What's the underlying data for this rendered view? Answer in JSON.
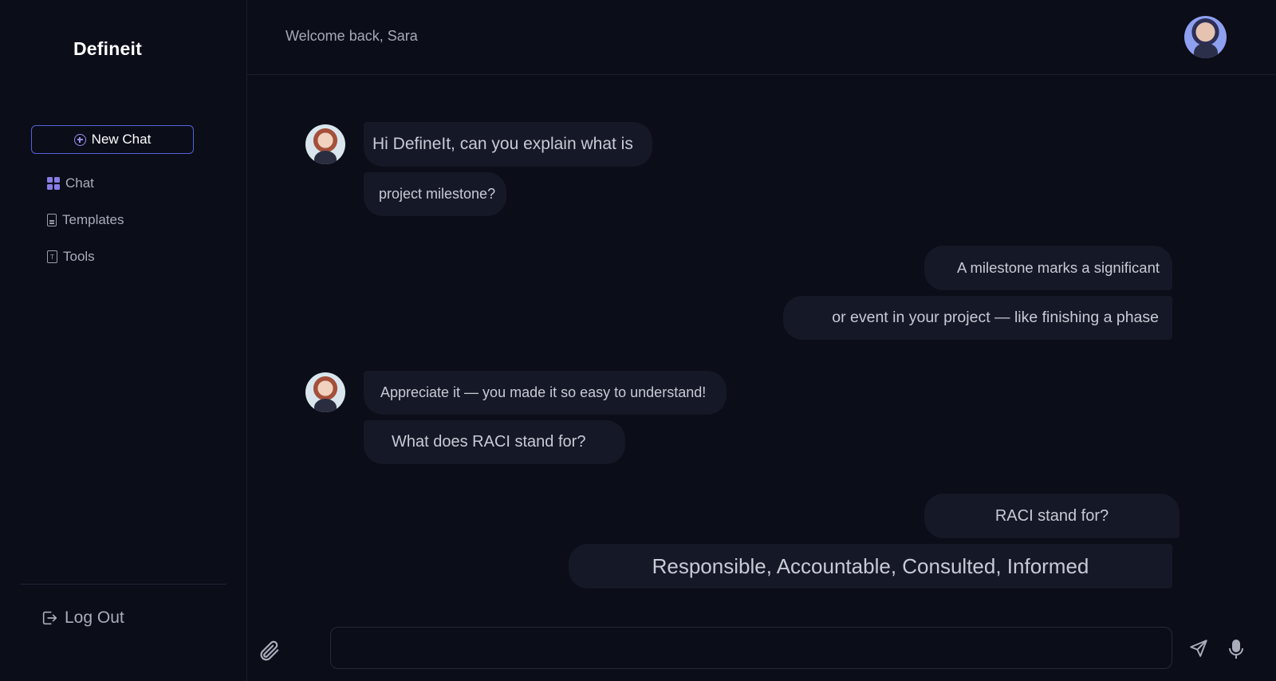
{
  "app": {
    "name": "Defineit"
  },
  "sidebar": {
    "new_chat_label": "New Chat",
    "items": [
      {
        "label": "Chat",
        "icon": "grid-icon"
      },
      {
        "label": "Templates",
        "icon": "document-icon"
      },
      {
        "label": "Tools",
        "icon": "tools-icon"
      }
    ],
    "logout_label": "Log Out"
  },
  "header": {
    "welcome": "Welcome back, Sara",
    "avatar_icon": "user-avatar"
  },
  "messages": [
    {
      "from": "user",
      "lines": [
        "Hi DefineIt, can you explain what is",
        "project milestone?"
      ]
    },
    {
      "from": "assistant",
      "lines": [
        "A milestone marks a significant",
        "or event in your project — like finishing a phase"
      ]
    },
    {
      "from": "user",
      "lines": [
        "Appreciate it — you made it so easy to understand!",
        "What does RACI stand for?"
      ]
    },
    {
      "from": "assistant",
      "lines": [
        "RACI stand for?",
        "Responsible, Accountable, Consulted, Informed"
      ]
    }
  ],
  "composer": {
    "placeholder": "",
    "attach_icon": "paperclip-icon",
    "send_icon": "send-icon",
    "mic_icon": "microphone-icon"
  },
  "colors": {
    "background": "#0b0d18",
    "bubble": "#151826",
    "accent": "#5463d6",
    "accent_icon": "#8a7ae6"
  }
}
